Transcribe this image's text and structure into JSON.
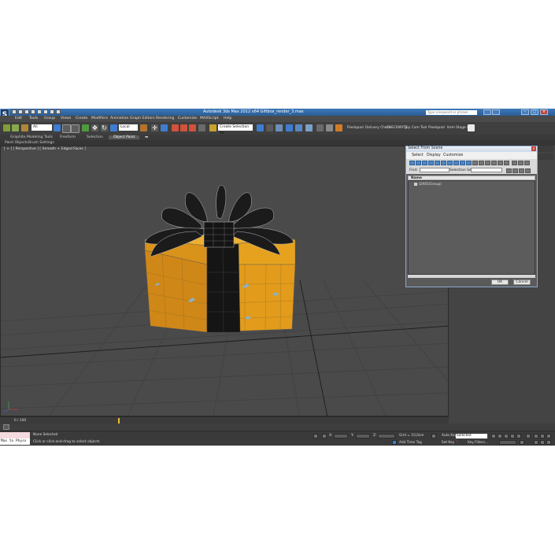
{
  "window": {
    "logo": "S",
    "title": "Autodesk 3ds Max 2012 x64     Giftbox_render_3.max",
    "search_placeholder": "Type a keyword or phrase",
    "min": "–",
    "max": "□",
    "close": "×"
  },
  "menus": [
    "Edit",
    "Tools",
    "Group",
    "Views",
    "Create",
    "Modifiers",
    "Animation",
    "Graph Editors",
    "Rendering",
    "Customize",
    "MAXScript",
    "Help"
  ],
  "toolbar": {
    "filter": "All",
    "coord": "Local",
    "named_selection": "Create Selection Se",
    "right_labels": [
      "Pixelquad",
      "Delivery Check",
      "CHECKMATE",
      "Joy Cam Tool",
      "Pixelquad",
      "Item Stage v1"
    ]
  },
  "ribbon": {
    "tabs": [
      "Graphite Modeling Tools",
      "Freeform",
      "Selection",
      "Object Paint"
    ],
    "active": "Object Paint",
    "sub": [
      "Paint Objects",
      "Brush Settings"
    ]
  },
  "viewport": {
    "label": "[ + ] [ Perspective ] [ Smooth + Edged Faces ]"
  },
  "dialog": {
    "title": "Select From Scene",
    "close": "x",
    "menus": [
      "Select",
      "Display",
      "Customize"
    ],
    "find_label": "Find:",
    "selection_set_label": "Selection Set:",
    "column_header": "Name",
    "rows": [
      "Gift01(Group)"
    ],
    "ok": "OK",
    "cancel": "Cancel"
  },
  "timeline": {
    "frame": "0 / 100"
  },
  "status": {
    "listener": "Max to Physx",
    "selected": "None Selected",
    "prompt": "Click or click-and-drag to select objects",
    "x_label": "X:",
    "y_label": "Y:",
    "z_label": "Z:",
    "grid": "Grid = 10,0cm",
    "add_time_tag": "Add Time Tag",
    "auto_key": "Auto Key",
    "selected_mode": "Selected",
    "set_key": "Set Key",
    "key_filters": "Key Filters..."
  },
  "colors": {
    "box_orange": "#e8a11c",
    "ribbon_black": "#151515",
    "viewport_bg": "#4a4a4a",
    "title_blue": "#2f68a8"
  }
}
